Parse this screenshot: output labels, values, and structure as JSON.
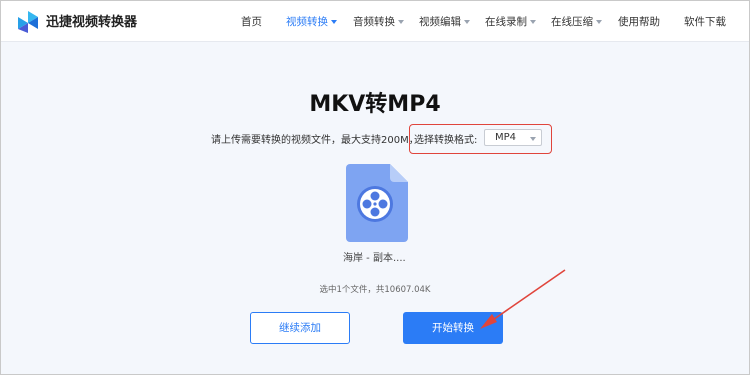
{
  "header": {
    "brand": "迅捷视频转换器",
    "nav": [
      {
        "label": "首页",
        "dropdown": false,
        "active": false
      },
      {
        "label": "视频转换",
        "dropdown": true,
        "active": true
      },
      {
        "label": "音频转换",
        "dropdown": true,
        "active": false
      },
      {
        "label": "视频编辑",
        "dropdown": true,
        "active": false
      },
      {
        "label": "在线录制",
        "dropdown": true,
        "active": false
      },
      {
        "label": "在线压缩",
        "dropdown": true,
        "active": false
      },
      {
        "label": "使用帮助",
        "dropdown": false,
        "active": false
      },
      {
        "label": "软件下载",
        "dropdown": false,
        "active": false
      }
    ]
  },
  "main": {
    "title": "MKV转MP4",
    "instruction": "请上传需要转换的视频文件，最大支持200M，",
    "format_label": "选择转换格式:",
    "format_selected": "MP4",
    "file": {
      "name": "海岸 - 副本....",
      "icon": "video-file-icon"
    },
    "summary": "选中1个文件，共10607.04K",
    "add_button": "继续添加",
    "start_button": "开始转换"
  },
  "colors": {
    "accent": "#2b7cf6",
    "highlight": "#e0453c",
    "background": "#f4f7fc"
  }
}
